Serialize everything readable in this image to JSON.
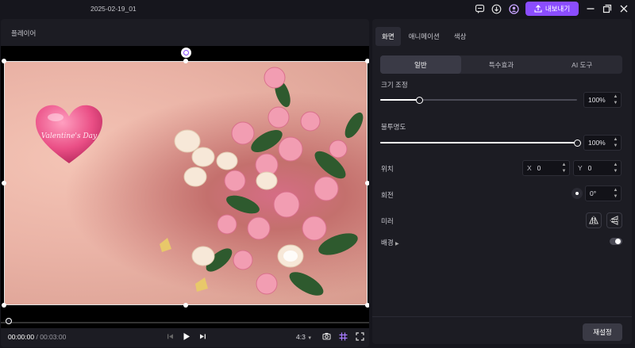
{
  "titlebar": {
    "document_title": "2025-02-19_01",
    "export_label": "내보내기",
    "icons": [
      "chat-icon",
      "download-icon",
      "account-icon",
      "minimize-icon",
      "restore-icon",
      "close-icon"
    ]
  },
  "player": {
    "title": "플레이어",
    "current_time": "00:00:00",
    "separator": "/",
    "total_time": "00:03:00",
    "progress": 0,
    "aspect_ratio": "4:3",
    "image_text": "Valentine's Day"
  },
  "properties": {
    "tabs": [
      "화면",
      "애니메이션",
      "색상"
    ],
    "active_tab": 0,
    "subtabs": [
      "일반",
      "특수효과",
      "AI 도구"
    ],
    "active_subtab": 0,
    "scale": {
      "label": "크기 조정",
      "value": "100%",
      "level": 0.2
    },
    "opacity": {
      "label": "불투명도",
      "value": "100%",
      "level": 1.0
    },
    "position": {
      "label": "위치",
      "x_label": "X",
      "x_value": "0",
      "y_label": "Y",
      "y_value": "0"
    },
    "rotation": {
      "label": "회전",
      "value": "0°"
    },
    "mirror": {
      "label": "미러"
    },
    "background": {
      "label": "배경",
      "enabled": false
    },
    "reset_label": "재설정"
  },
  "colors": {
    "accent": "#8b4dff",
    "panel": "#1c1c23",
    "app_background": "#16161d"
  }
}
